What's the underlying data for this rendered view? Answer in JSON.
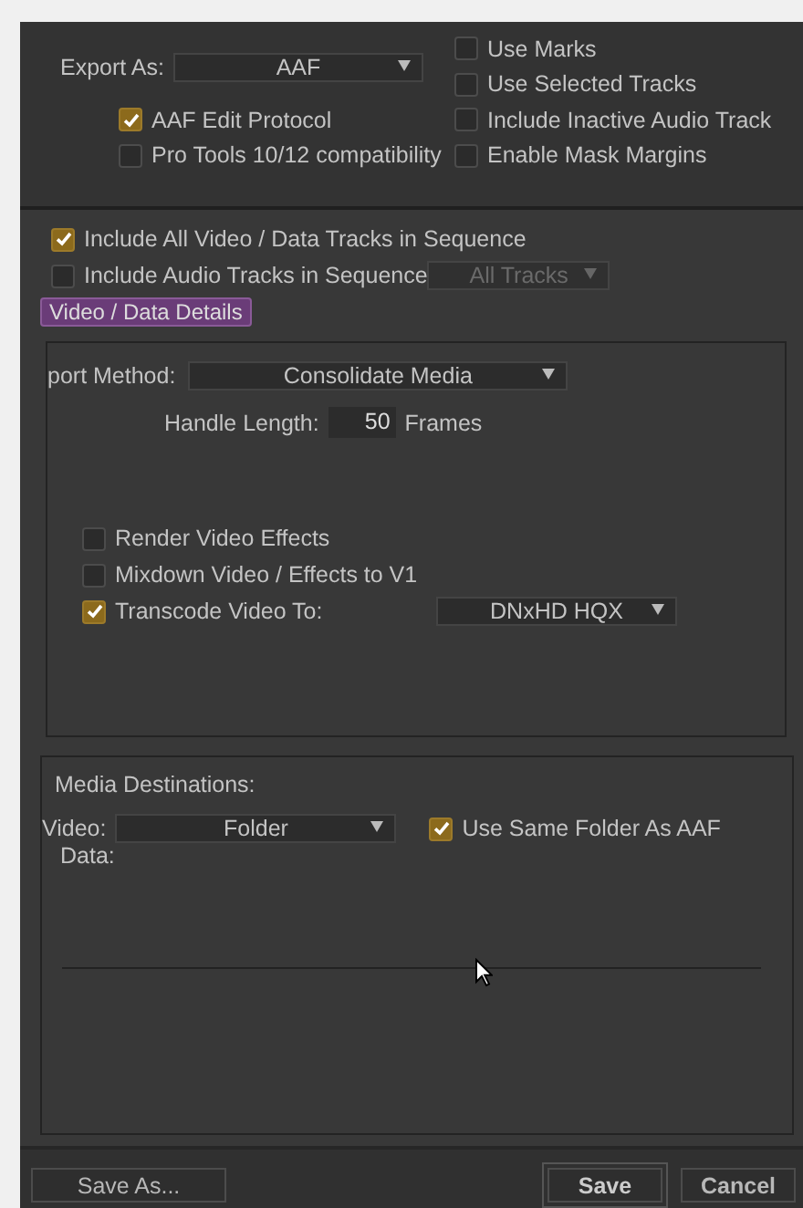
{
  "export_as": {
    "label": "Export As:",
    "value": "AAF"
  },
  "left_options": [
    {
      "label": "AAF Edit Protocol",
      "checked": true
    },
    {
      "label": "Pro Tools 10/12 compatibility",
      "checked": false
    }
  ],
  "right_options": [
    {
      "label": "Use Marks",
      "checked": false
    },
    {
      "label": "Use Selected Tracks",
      "checked": false
    },
    {
      "label": "Include Inactive Audio Track",
      "checked": false
    },
    {
      "label": "Enable Mask Margins",
      "checked": false
    }
  ],
  "tracks": [
    {
      "label": "Include All Video / Data Tracks in Sequence",
      "checked": true
    },
    {
      "label": "Include Audio Tracks in Sequence",
      "checked": false,
      "dropdown": {
        "value": "All Tracks",
        "disabled": true
      }
    }
  ],
  "details_tab": {
    "label": "Video / Data Details",
    "selected": true
  },
  "export_method": {
    "label": "port Method:",
    "value": "Consolidate Media"
  },
  "handle_length": {
    "label": "Handle Length:",
    "value": "50",
    "unit": "Frames"
  },
  "video_options": [
    {
      "label": "Render Video Effects",
      "checked": false
    },
    {
      "label": "Mixdown Video / Effects to V1",
      "checked": false
    },
    {
      "label": "Transcode Video To:",
      "checked": true,
      "dropdown": {
        "value": "DNxHD HQX",
        "disabled": false
      }
    }
  ],
  "media_destinations": {
    "title": "Media Destinations:",
    "video_label": "Video:",
    "video_value": "Folder",
    "same_folder": {
      "label": "Use Same Folder As AAF",
      "checked": true
    },
    "data_label": "Data:"
  },
  "buttons": [
    {
      "label": "Save As...",
      "kind": "secondary"
    },
    {
      "label": "Save",
      "kind": "default"
    },
    {
      "label": "Cancel",
      "kind": "secondary"
    }
  ]
}
